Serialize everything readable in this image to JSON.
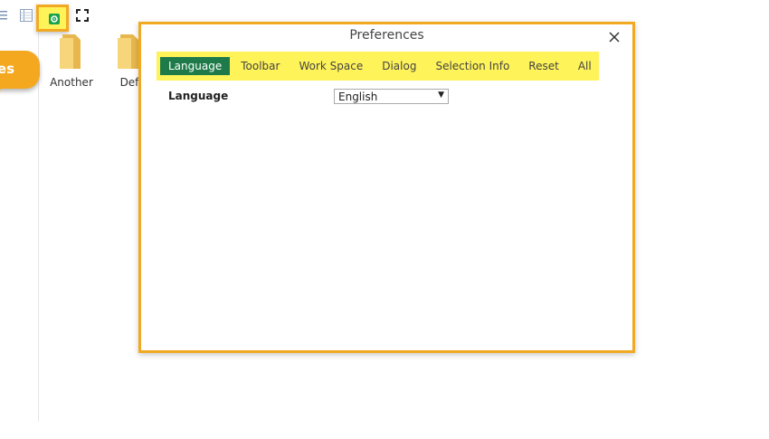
{
  "toolbar": {
    "icons": [
      "list-icon",
      "details-icon",
      "gear-icon",
      "fullscreen-icon"
    ],
    "accent": "#17a34a"
  },
  "callout": {
    "label": "es",
    "color": "#f4a81f"
  },
  "files": [
    {
      "name": "Another",
      "icon": "folder-icon"
    },
    {
      "name": "Def",
      "icon": "folder-icon"
    }
  ],
  "dialog": {
    "title": "Preferences",
    "close_icon": "close-icon",
    "tabs": [
      {
        "label": "Language",
        "active": true
      },
      {
        "label": "Toolbar",
        "active": false
      },
      {
        "label": "Work Space",
        "active": false
      },
      {
        "label": "Dialog",
        "active": false
      },
      {
        "label": "Selection Info",
        "active": false
      },
      {
        "label": "Reset",
        "active": false
      },
      {
        "label": "All",
        "active": false
      }
    ],
    "language_label": "Language",
    "language_value": "English",
    "highlight_color": "#fff35a",
    "active_tab_color": "#1e7b49",
    "frame_color": "#f2a922"
  }
}
